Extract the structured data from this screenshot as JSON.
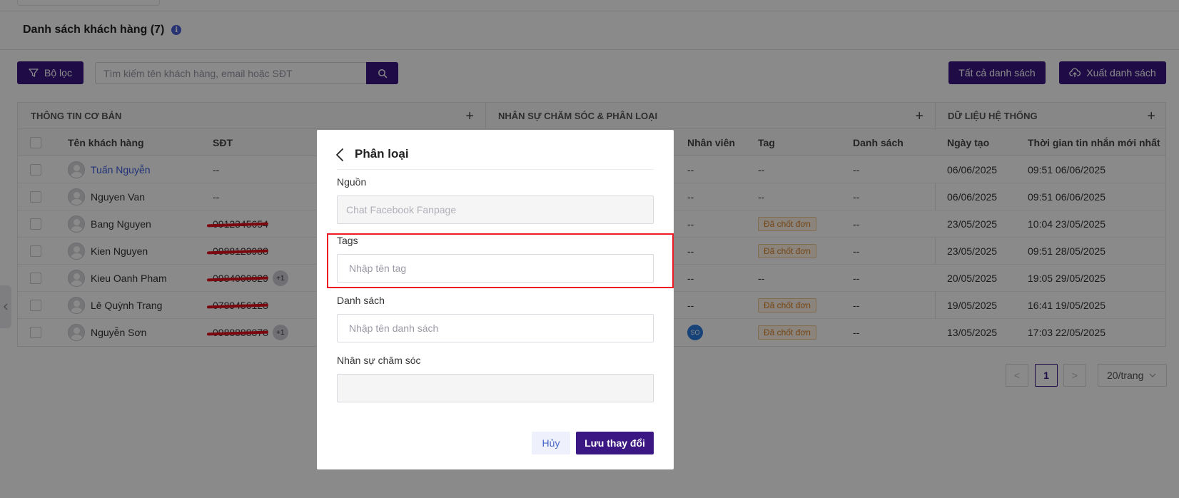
{
  "list": {
    "title": "Danh sách khách hàng (7)",
    "info_icon": "i"
  },
  "toolbar": {
    "filter_label": "Bộ lọc",
    "search_placeholder": "Tìm kiếm tên khách hàng, email hoặc SĐT",
    "all_lists_label": "Tất cả danh sách",
    "export_label": "Xuất danh sách"
  },
  "table": {
    "groups": [
      {
        "label": "THÔNG TIN CƠ BẢN",
        "plus": "+"
      },
      {
        "label": "NHÂN SỰ CHĂM SÓC & PHÂN LOẠI",
        "plus": "+"
      },
      {
        "label": "DỮ LIỆU HỆ THỐNG",
        "plus": "+"
      }
    ],
    "columns": {
      "name": "Tên khách hàng",
      "phone": "SĐT",
      "staff": "Nhân viên",
      "tag": "Tag",
      "list": "Danh sách",
      "created": "Ngày tạo",
      "last_msg": "Thời gian tin nhắn mới nhất"
    },
    "rows": [
      {
        "name": "Tuấn Nguyễn",
        "phone": "--",
        "extra": "",
        "staff": "--",
        "tag": "--",
        "list": "--",
        "created": "06/06/2025",
        "last_msg": "09:51 06/06/2025"
      },
      {
        "name": "Nguyen Van",
        "phone": "--",
        "extra": "",
        "staff": "--",
        "tag": "--",
        "list": "--",
        "created": "06/06/2025",
        "last_msg": "09:51 06/06/2025"
      },
      {
        "name": "Bang Nguyen",
        "phone": "0912345654",
        "extra": "",
        "staff": "--",
        "tag": "Đã chốt đơn",
        "list": "--",
        "created": "23/05/2025",
        "last_msg": "10:04 23/05/2025"
      },
      {
        "name": "Kien Nguyen",
        "phone": "0988123988",
        "extra": "",
        "staff": "--",
        "tag": "Đã chốt đơn",
        "list": "--",
        "created": "23/05/2025",
        "last_msg": "09:51 28/05/2025"
      },
      {
        "name": "Kieu Oanh Pham",
        "phone": "0984000829",
        "extra": "+1",
        "staff": "--",
        "tag": "--",
        "list": "--",
        "created": "20/05/2025",
        "last_msg": "19:05 29/05/2025"
      },
      {
        "name": "Lê Quỳnh Trang",
        "phone": "0789456123",
        "extra": "",
        "staff": "--",
        "tag": "Đã chốt đơn",
        "list": "--",
        "created": "19/05/2025",
        "last_msg": "16:41 19/05/2025"
      },
      {
        "name": "Nguyễn Sơn",
        "phone": "0988888878",
        "extra": "+1",
        "staff": "SO",
        "tag": "Đã chốt đơn",
        "list": "--",
        "created": "13/05/2025",
        "last_msg": "17:03 22/05/2025"
      }
    ]
  },
  "pagination": {
    "prev": "<",
    "current": "1",
    "next": ">",
    "page_size": "20/trang"
  },
  "modal": {
    "title": "Phân loại",
    "source_label": "Nguồn",
    "source_value": "Chat Facebook Fanpage",
    "tags_label": "Tags",
    "tags_placeholder": "Nhập tên tag",
    "list_label": "Danh sách",
    "list_placeholder": "Nhập tên danh sách",
    "staff_label": "Nhân sự chăm sóc",
    "staff_value": "",
    "cancel_label": "Hủy",
    "save_label": "Lưu thay đổi"
  },
  "colors": {
    "primary": "#3a1782",
    "highlight": "#ee1b24",
    "tag_orange": "#d8812a",
    "link_blue": "#3b5bdb"
  },
  "icons": {
    "filter": "filter-icon",
    "search": "search-icon",
    "export": "cloud-upload-icon",
    "back": "chevron-left-icon",
    "info": "info-icon",
    "avatar": "user-avatar-icon"
  }
}
